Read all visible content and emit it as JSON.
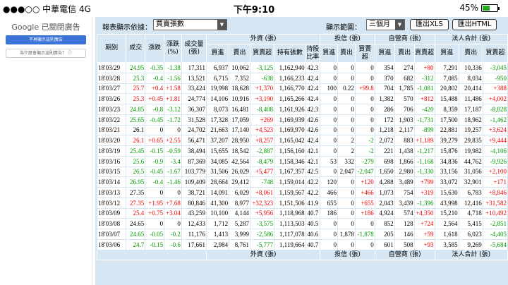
{
  "status": {
    "carrier": "●●●○○ 中華電信 4G",
    "time": "下午9:10",
    "battery": "45%"
  },
  "ad": {
    "title": "Google 已關閉廣告",
    "stop_btn": "不再顯示這則廣告",
    "why_btn": "為什麼會顯示這則廣告？ ⓘ"
  },
  "toolbar": {
    "report_label": "報表顯示依據：",
    "report_value": "買賣張數",
    "range_label": "顯示範圍：",
    "range_value": "三個月",
    "xls": "匯出XLS",
    "html": "匯出HTML"
  },
  "headers": {
    "date": "期別",
    "close": "成交",
    "chg": "漲跌",
    "pct": "漲跌 (%)",
    "vol": "成交量 (張)",
    "foreign": "外資 (張)",
    "trust": "投信 (張)",
    "dealer": "自營商 (張)",
    "legal": "法人合計 (張)",
    "buy": "買進",
    "sell": "賣出",
    "net": "買賣超",
    "hold": "持有張數",
    "ratio": "持股比率"
  },
  "colors": {
    "up": "#e00000",
    "down": "#009900",
    "header_bg": "#d6e6f3"
  },
  "rows": [
    [
      "18'03/29",
      "24.95",
      "-0.35",
      "-1.38",
      "17,311",
      "6,937",
      "10,062",
      "-3,125",
      "1,162,940",
      "42.3",
      "0",
      "0",
      "0",
      "354",
      "274",
      "+80",
      "7,291",
      "10,336",
      "-3,045"
    ],
    [
      "18'03/28",
      "25.3",
      "-0.4",
      "-1.56",
      "13,521",
      "6,715",
      "7,352",
      "-638",
      "1,166,233",
      "42.4",
      "0",
      "0",
      "0",
      "370",
      "682",
      "-312",
      "7,085",
      "8,034",
      "-950"
    ],
    [
      "18'03/27",
      "25.7",
      "+0.4",
      "+1.58",
      "33,424",
      "19,998",
      "18,628",
      "+1,370",
      "1,166,770",
      "42.4",
      "100",
      "0.22",
      "+99.8",
      "704",
      "1,785",
      "-1,081",
      "20,802",
      "20,414",
      "+388"
    ],
    [
      "18'03/26",
      "25.3",
      "+0.45",
      "+1.81",
      "24,774",
      "14,106",
      "10,916",
      "+3,190",
      "1,165,266",
      "42.4",
      "0",
      "0",
      "0",
      "1,382",
      "570",
      "+812",
      "15,488",
      "11,486",
      "+4,002"
    ],
    [
      "18'03/23",
      "24.85",
      "-0.8",
      "-3.12",
      "36,307",
      "8,073",
      "16,481",
      "-8,408",
      "1,161,926",
      "42.3",
      "0",
      "0",
      "0",
      "286",
      "706",
      "-420",
      "8,359",
      "17,187",
      "-8,828"
    ],
    [
      "18'03/22",
      "25.65",
      "-0.45",
      "-1.72",
      "31,528",
      "17,328",
      "17,059",
      "+269",
      "1,169,939",
      "42.6",
      "0",
      "0",
      "0",
      "172",
      "1,903",
      "-1,731",
      "17,500",
      "18,962",
      "-1,462"
    ],
    [
      "18'03/21",
      "26.1",
      "0",
      "0",
      "24,702",
      "21,663",
      "17,140",
      "+4,523",
      "1,169,970",
      "42.6",
      "0",
      "0",
      "0",
      "1,218",
      "2,117",
      "-899",
      "22,881",
      "19,257",
      "+3,624"
    ],
    [
      "18'03/20",
      "26.1",
      "+0.65",
      "+2.55",
      "56,471",
      "37,207",
      "28,950",
      "+8,257",
      "1,165,042",
      "42.4",
      "0",
      "2",
      "-2",
      "2,072",
      "883",
      "+1,189",
      "39,279",
      "29,835",
      "+9,444"
    ],
    [
      "18'03/19",
      "25.45",
      "-0.15",
      "-0.59",
      "38,494",
      "15,655",
      "18,542",
      "-2,887",
      "1,156,160",
      "42.1",
      "0",
      "2",
      "-2",
      "221",
      "1,438",
      "-1,217",
      "15,876",
      "19,982",
      "-4,106"
    ],
    [
      "18'03/16",
      "25.6",
      "-0.9",
      "-3.4",
      "87,369",
      "34,085",
      "42,564",
      "-8,479",
      "1,158,346",
      "42.1",
      "53",
      "332",
      "-279",
      "698",
      "1,866",
      "-1,168",
      "34,836",
      "44,762",
      "-9,926"
    ],
    [
      "18'03/15",
      "26.5",
      "-0.45",
      "-1.67",
      "103,779",
      "31,506",
      "26,029",
      "+5,477",
      "1,167,357",
      "42.5",
      "0",
      "2,047",
      "-2,047",
      "1,650",
      "2,980",
      "-1,330",
      "33,156",
      "31,056",
      "+2,100"
    ],
    [
      "18'03/14",
      "26.95",
      "-0.4",
      "-1.46",
      "109,409",
      "28,664",
      "29,412",
      "-748",
      "1,159,014",
      "42.2",
      "120",
      "0",
      "+120",
      "4,288",
      "3,489",
      "+799",
      "33,072",
      "32,901",
      "+171"
    ],
    [
      "18'03/13",
      "27.35",
      "0",
      "0",
      "38,721",
      "14,091",
      "6,029",
      "+8,061",
      "1,159,567",
      "42.2",
      "466",
      "0",
      "+466",
      "1,073",
      "754",
      "+319",
      "15,630",
      "6,783",
      "+8,846"
    ],
    [
      "18'03/12",
      "27.35",
      "+1.95",
      "+7.68",
      "80,846",
      "41,300",
      "8,977",
      "+32,323",
      "1,151,506",
      "41.9",
      "655",
      "0",
      "+655",
      "2,043",
      "3,439",
      "-1,396",
      "43,998",
      "12,416",
      "+31,582"
    ],
    [
      "18'03/09",
      "25.4",
      "+0.75",
      "+3.04",
      "43,259",
      "10,100",
      "4,144",
      "+5,956",
      "1,118,968",
      "40.7",
      "186",
      "0",
      "+186",
      "4,924",
      "574",
      "+4,350",
      "15,210",
      "4,718",
      "+10,492"
    ],
    [
      "18'03/08",
      "24.65",
      "0",
      "0",
      "12,433",
      "1,712",
      "5,287",
      "-3,575",
      "1,113,503",
      "40.5",
      "0",
      "0",
      "0",
      "852",
      "128",
      "+724",
      "2,564",
      "5,415",
      "-2,851"
    ],
    [
      "18'03/07",
      "24.65",
      "-0.05",
      "-0.2",
      "11,176",
      "1,413",
      "3,999",
      "-2,586",
      "1,117,078",
      "40.6",
      "0",
      "1,878",
      "-1,878",
      "205",
      "146",
      "+59",
      "1,618",
      "6,023",
      "-4,405"
    ],
    [
      "18'03/06",
      "24.7",
      "-0.15",
      "-0.6",
      "17,661",
      "2,984",
      "8,761",
      "-5,777",
      "1,119,664",
      "40.7",
      "0",
      "0",
      "0",
      "601",
      "508",
      "+93",
      "3,585",
      "9,269",
      "-5,684"
    ]
  ]
}
